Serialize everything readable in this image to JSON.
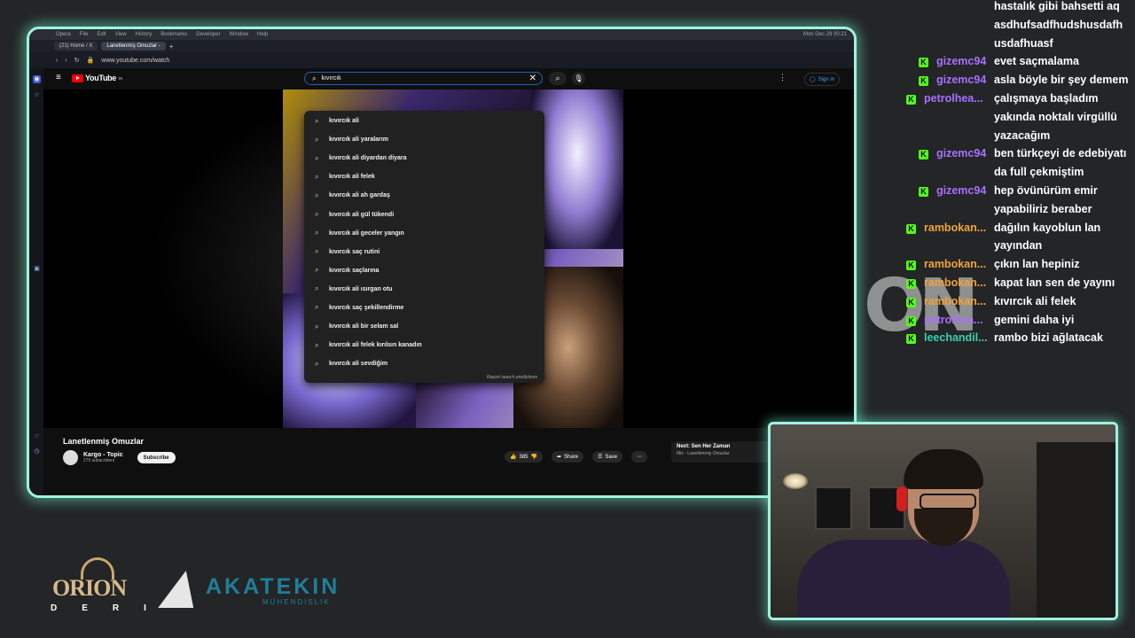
{
  "mac_menu": [
    "Opera",
    "File",
    "Edit",
    "View",
    "History",
    "Bookmarks",
    "Developer",
    "Window",
    "Help"
  ],
  "mac_clock": "Mon Dec 29 00:21",
  "browser": {
    "tabs": [
      {
        "label": "(21) Home / X",
        "active": false
      },
      {
        "label": "Lanetlenmiş Omuzlar -",
        "active": true
      }
    ],
    "new_tab_label": "+",
    "url": "www.youtube.com/watch"
  },
  "youtube": {
    "logo_text": "YouTube",
    "logo_sup": "TR",
    "search_value": "kıvırcık",
    "sign_in": "Sign in",
    "suggestions": [
      "kıvırcık ali",
      "kıvırcık ali yaralarım",
      "kıvırcık ali diyardan diyara",
      "kıvırcık ali felek",
      "kıvırcık ali ah gardaş",
      "kıvırcık ali gül tükendi",
      "kıvırcık ali geceler yangın",
      "kıvırcık saç rutini",
      "kıvırcık saçlarına",
      "kıvırcık ali ısırgan otu",
      "kıvırcık saç şekillendirme",
      "kıvırcık ali bir selam sal",
      "kıvırcık ali felek kırılsın kanadın",
      "kıvırcık ali sevdiğim"
    ],
    "report_text": "Report search predictions",
    "video_title": "Lanetlenmiş Omuzlar",
    "channel_name": "Kargo - Topic",
    "channel_subs": "279 subscribers",
    "subscribe": "Subscribe",
    "likes": "385",
    "share": "Share",
    "save": "Save",
    "next_title": "Next: Sen Her Zaman",
    "next_sub": "Mix - Lanetlenmiş Omuzlar"
  },
  "chat": {
    "overflow_lines": [
      "hastalık gibi bahsetti aq",
      "asdhufsadfhudshusdafh",
      "usdafhuasf"
    ],
    "messages": [
      {
        "user": "gizemc94",
        "color": "#a970ff",
        "text": [
          "evet saçmalama"
        ]
      },
      {
        "user": "gizemc94",
        "color": "#a970ff",
        "text": [
          "asla böyle bir şey demem"
        ]
      },
      {
        "user": "petrolhea...",
        "color": "#a970ff",
        "text": [
          "çalışmaya başladım",
          "yakında noktalı virgüllü",
          "yazacağım"
        ]
      },
      {
        "user": "gizemc94",
        "color": "#a970ff",
        "text": [
          "ben türkçeyi de edebiyatı",
          "da full çekmiştim"
        ]
      },
      {
        "user": "gizemc94",
        "color": "#a970ff",
        "text": [
          "hep övünürüm emir",
          "yapabiliriz beraber"
        ]
      },
      {
        "user": "rambokan...",
        "color": "#f3a33b",
        "text": [
          "dağılın kayoblun lan",
          "yayından"
        ]
      },
      {
        "user": "rambokan...",
        "color": "#f3a33b",
        "text": [
          "çıkın lan hepiniz"
        ]
      },
      {
        "user": "rambokan...",
        "color": "#f3a33b",
        "text": [
          "kapat lan sen de yayını"
        ]
      },
      {
        "user": "rambokan...",
        "color": "#f3a33b",
        "text": [
          "kıvırcık ali felek"
        ]
      },
      {
        "user": "petrolhea...",
        "color": "#a970ff",
        "text": [
          "gemini daha iyi"
        ]
      },
      {
        "user": "leechandil...",
        "color": "#3ad1b1",
        "text": [
          "rambo bizi ağlatacak"
        ]
      }
    ]
  },
  "overlay": {
    "on_logo": "ON",
    "sponsor1_name": "ORION",
    "sponsor1_sub": "DERI",
    "sponsor2_name": "AKATEKIN",
    "sponsor2_sub": "MÜHENDİSLİK"
  }
}
